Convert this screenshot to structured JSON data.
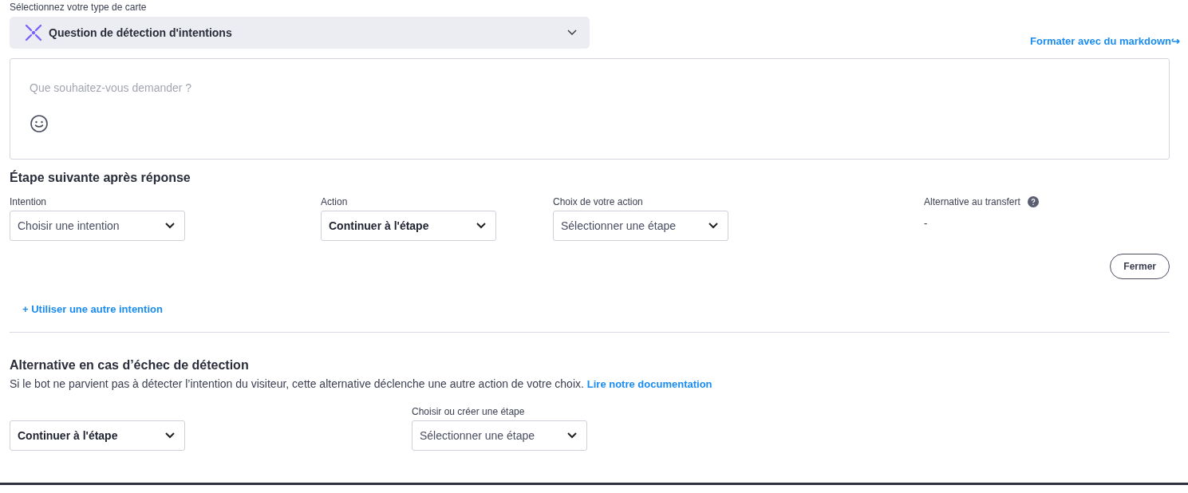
{
  "card_type": {
    "label": "Sélectionnez votre type de carte",
    "value": "Question de détection d'intentions"
  },
  "markdown_link": "Formater avec du markdown↪",
  "question": {
    "placeholder": "Que souhaitez-vous demander ?"
  },
  "next_step": {
    "title": "Étape suivante après réponse",
    "fields": [
      {
        "label": "Intention",
        "placeholder": "Choisir une intention"
      },
      {
        "label": "Action",
        "value": "Continuer à l'étape"
      },
      {
        "label": "Choix de votre action",
        "placeholder": "Sélectionner une étape"
      }
    ],
    "fallback_label": "Alternative au transfert",
    "fallback_value": "-",
    "close_button": "Fermer"
  },
  "add_intent_link": "+ Utiliser une autre intention",
  "failure": {
    "title": "Alternative en cas d’échec de détection",
    "description": "Si le bot ne parvient pas à détecter l’intention du visiteur, cette alternative déclenche une autre action de votre choix.",
    "doc_link": "Lire notre documentation",
    "fields": [
      {
        "value": "Continuer à l'étape"
      },
      {
        "label": "Choisir ou créer une étape",
        "placeholder": "Sélectionner une étape"
      }
    ]
  }
}
